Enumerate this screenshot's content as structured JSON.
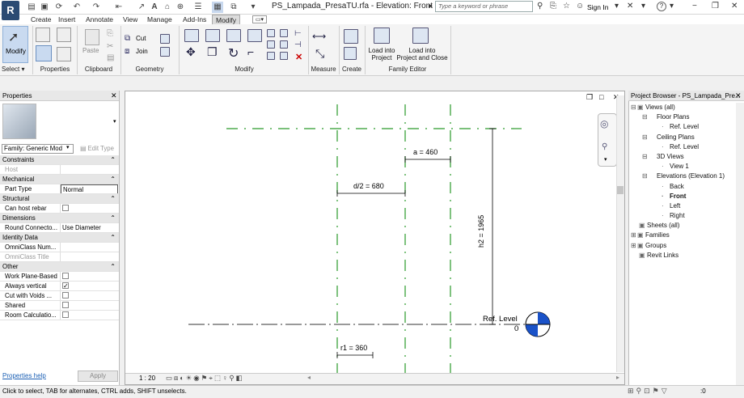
{
  "app": {
    "logo": "R",
    "title": "PS_Lampada_PresaTU.rfa - Elevation: Front",
    "search_placeholder": "Type a keyword or phrase",
    "sign_in": "Sign In",
    "help": "?"
  },
  "tabs": [
    "Create",
    "Insert",
    "Annotate",
    "View",
    "Manage",
    "Add-Ins",
    "Modify"
  ],
  "ribbon": {
    "modify_label": "Modify",
    "select_label": "Select ▾",
    "panels": [
      "Properties",
      "Clipboard",
      "Geometry",
      "Modify",
      "Measure",
      "Create",
      "Family Editor"
    ],
    "paste": "Paste",
    "cut": "Cut",
    "join": "Join",
    "load_project": "Load into\nProject",
    "load_close": "Load into\nProject and Close",
    "load_project_l1": "Load into",
    "load_project_l2": "Project",
    "load_close_l1": "Load into",
    "load_close_l2": "Project and Close"
  },
  "properties": {
    "title": "Properties",
    "family": "Family: Generic Mod",
    "edit_type": "Edit Type",
    "rows": [
      {
        "cat": true,
        "label": "Constraints"
      },
      {
        "label": "Host",
        "value": "",
        "grey": true
      },
      {
        "cat": true,
        "label": "Mechanical"
      },
      {
        "label": "Part Type",
        "value": "Normal",
        "box": true
      },
      {
        "cat": true,
        "label": "Structural"
      },
      {
        "label": "Can host rebar",
        "check": false
      },
      {
        "cat": true,
        "label": "Dimensions"
      },
      {
        "label": "Round Connecto...",
        "value": "Use Diameter"
      },
      {
        "cat": true,
        "label": "Identity Data"
      },
      {
        "label": "OmniClass Num...",
        "value": ""
      },
      {
        "label": "OmniClass Title",
        "value": "",
        "grey": true
      },
      {
        "cat": true,
        "label": "Other"
      },
      {
        "label": "Work Plane-Based",
        "check": false
      },
      {
        "label": "Always vertical",
        "check": true
      },
      {
        "label": "Cut with Voids ...",
        "check": false
      },
      {
        "label": "Shared",
        "check": false
      },
      {
        "label": "Room Calculatio...",
        "check": false
      }
    ],
    "help_link": "Properties help",
    "apply": "Apply"
  },
  "canvas": {
    "dim_a": "a = 460",
    "dim_d2": "d/2 = 680",
    "dim_h2": "h2 = 1965",
    "dim_r1": "r1 = 360",
    "level_name": "Ref. Level",
    "level_value": "0",
    "scale": "1 : 20"
  },
  "browser": {
    "title": "Project Browser - PS_Lampada_Pre...",
    "items": [
      {
        "label": "Views (all)",
        "indent": 0,
        "exp": "-"
      },
      {
        "label": "Floor Plans",
        "indent": 1,
        "exp": "-"
      },
      {
        "label": "Ref. Level",
        "indent": 2
      },
      {
        "label": "Ceiling Plans",
        "indent": 1,
        "exp": "-"
      },
      {
        "label": "Ref. Level",
        "indent": 2
      },
      {
        "label": "3D Views",
        "indent": 1,
        "exp": "-"
      },
      {
        "label": "View 1",
        "indent": 2
      },
      {
        "label": "Elevations (Elevation 1)",
        "indent": 1,
        "exp": "-"
      },
      {
        "label": "Back",
        "indent": 2
      },
      {
        "label": "Front",
        "indent": 2,
        "bold": true
      },
      {
        "label": "Left",
        "indent": 2
      },
      {
        "label": "Right",
        "indent": 2
      },
      {
        "label": "Sheets (all)",
        "indent": 0
      },
      {
        "label": "Families",
        "indent": 0,
        "exp": "+"
      },
      {
        "label": "Groups",
        "indent": 0,
        "exp": "+"
      },
      {
        "label": "Revit Links",
        "indent": 0
      }
    ]
  },
  "status": {
    "text": "Click to select, TAB for alternates, CTRL adds, SHIFT unselects.",
    "filter": ":0"
  }
}
